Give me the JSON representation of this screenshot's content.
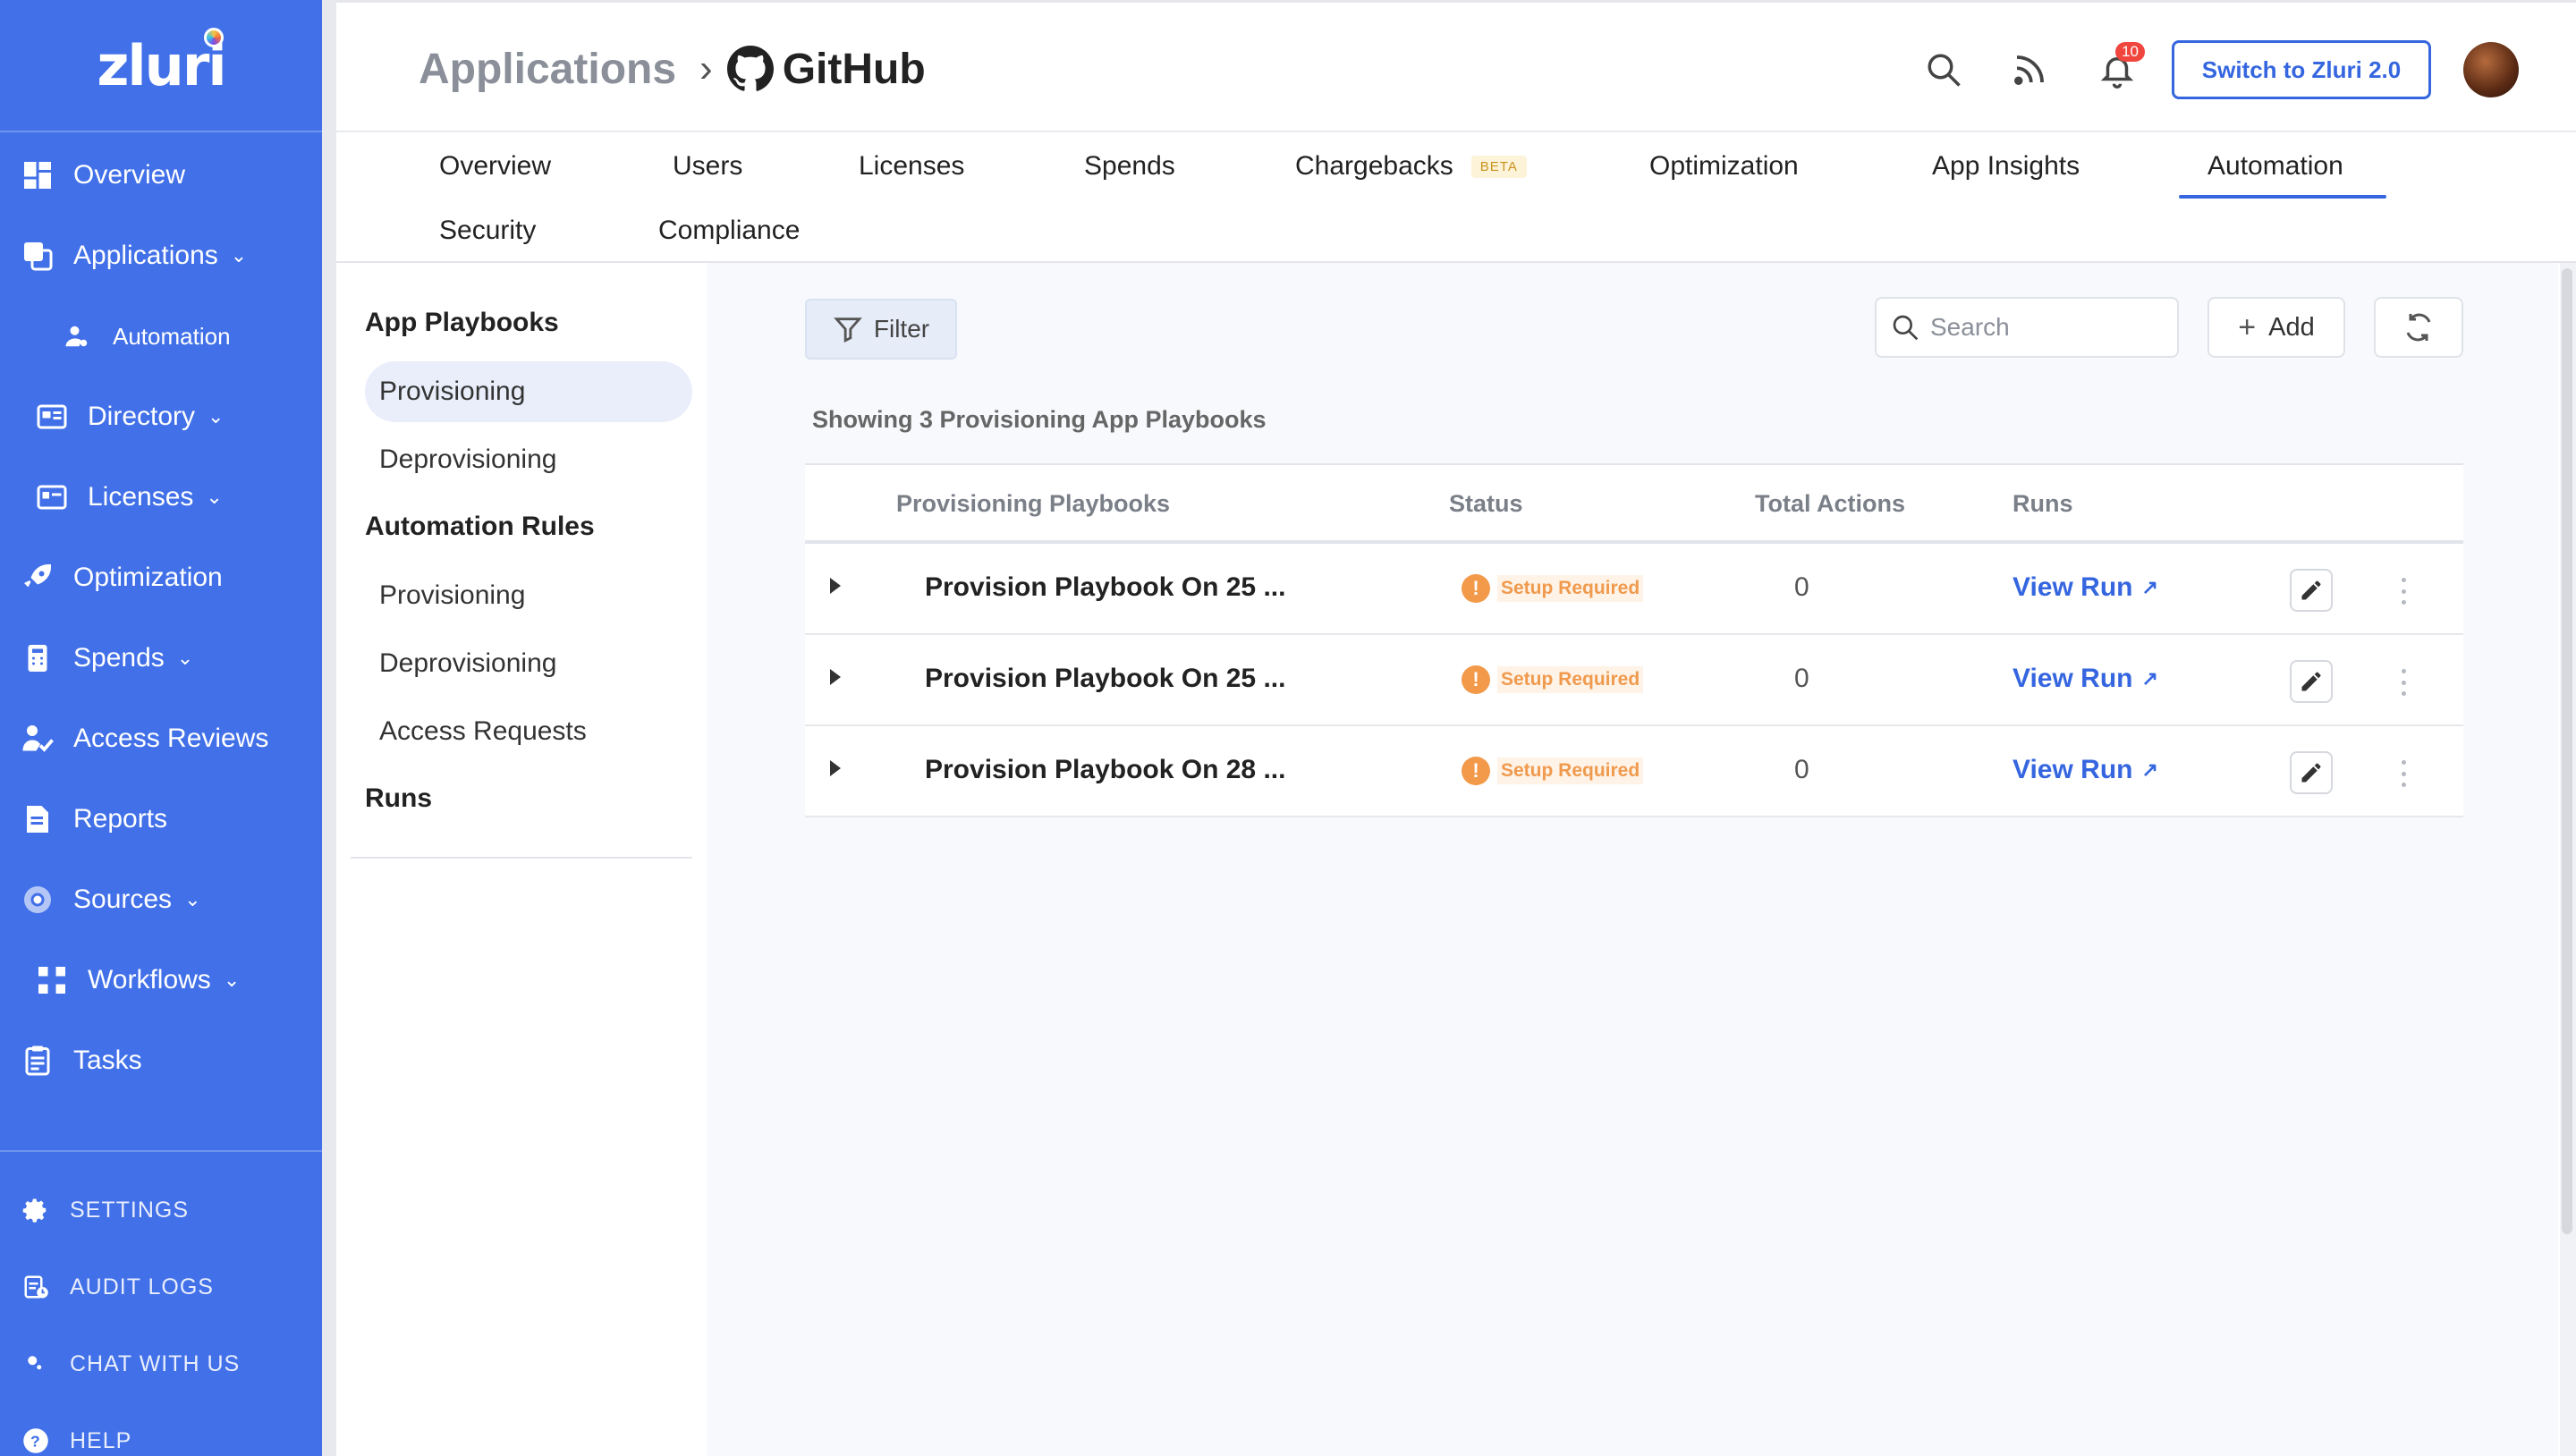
{
  "brand": {
    "logo_text": "zluri"
  },
  "sidebar": {
    "items": [
      {
        "label": "Overview",
        "icon": "dashboard-icon"
      },
      {
        "label": "Applications",
        "icon": "applications-icon",
        "expandable": true
      },
      {
        "label": "Automation",
        "icon": "user-gear-icon",
        "sub": true
      },
      {
        "label": "Directory",
        "icon": "directory-icon",
        "expandable": true
      },
      {
        "label": "Licenses",
        "icon": "license-icon",
        "expandable": true
      },
      {
        "label": "Optimization",
        "icon": "rocket-icon"
      },
      {
        "label": "Spends",
        "icon": "spends-icon",
        "expandable": true
      },
      {
        "label": "Access Reviews",
        "icon": "access-review-icon"
      },
      {
        "label": "Reports",
        "icon": "reports-icon"
      },
      {
        "label": "Sources",
        "icon": "sources-icon",
        "expandable": true
      },
      {
        "label": "Workflows",
        "icon": "workflow-icon",
        "expandable": true
      },
      {
        "label": "Tasks",
        "icon": "clipboard-icon"
      }
    ],
    "footer": [
      {
        "label": "SETTINGS",
        "icon": "gear-icon"
      },
      {
        "label": "AUDIT LOGS",
        "icon": "audit-log-icon"
      },
      {
        "label": "CHAT WITH US",
        "icon": "chat-icon"
      },
      {
        "label": "HELP",
        "icon": "help-icon"
      }
    ]
  },
  "header": {
    "breadcrumb_parent": "Applications",
    "breadcrumb_separator": "›",
    "app_name": "GitHub",
    "notification_count": "10",
    "switch_label": "Switch to Zluri 2.0"
  },
  "tabs": {
    "items": [
      "Overview",
      "Users",
      "Licenses",
      "Spends",
      "Chargebacks",
      "Optimization",
      "App Insights",
      "Automation",
      "Security",
      "Compliance"
    ],
    "beta_label": "BETA",
    "active": "Automation"
  },
  "subnav": {
    "app_playbooks_heading": "App Playbooks",
    "app_playbooks": [
      "Provisioning",
      "Deprovisioning"
    ],
    "automation_rules_heading": "Automation Rules",
    "automation_rules": [
      "Provisioning",
      "Deprovisioning",
      "Access Requests"
    ],
    "runs_heading": "Runs",
    "active": "Provisioning"
  },
  "toolbar": {
    "filter_label": "Filter",
    "search_placeholder": "Search",
    "add_label": "Add"
  },
  "summary": "Showing 3 Provisioning App Playbooks",
  "table": {
    "columns": [
      "Provisioning Playbooks",
      "Status",
      "Total Actions",
      "Runs"
    ],
    "rows": [
      {
        "name": "Provision Playbook On 25 ...",
        "status": "Setup Required",
        "total_actions": "0",
        "runs": "View Run"
      },
      {
        "name": "Provision Playbook On 25 ...",
        "status": "Setup Required",
        "total_actions": "0",
        "runs": "View Run"
      },
      {
        "name": "Provision Playbook On 28 ...",
        "status": "Setup Required",
        "total_actions": "0",
        "runs": "View Run"
      }
    ]
  },
  "colors": {
    "sidebar_bg": "#4170e8",
    "accent": "#3566e0",
    "status_warning": "#f29a4a"
  }
}
